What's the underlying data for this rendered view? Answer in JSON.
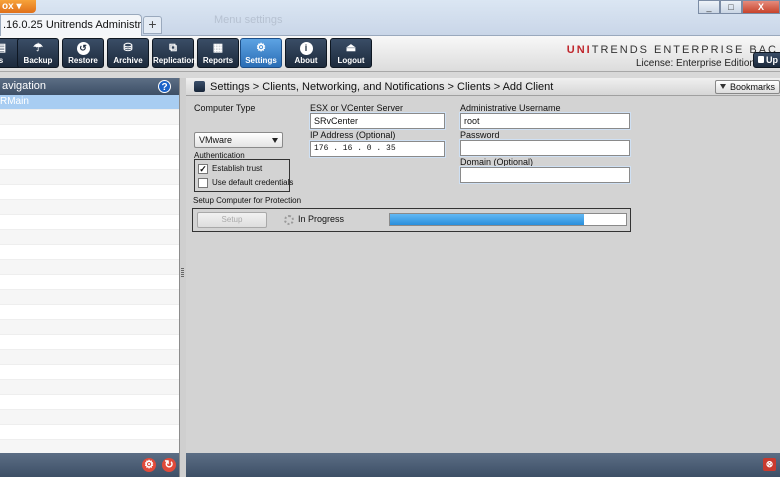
{
  "browser": {
    "menu_label": "ox",
    "tab_title": ".16.0.25 Unitrends Administrator Inter…",
    "new_tab": "+",
    "ghost_tab": "Menu settings",
    "window_buttons": [
      "_",
      "□",
      "X"
    ]
  },
  "toolbar": {
    "buttons": [
      {
        "label": "s",
        "icon": "status-icon"
      },
      {
        "label": "Backup",
        "icon": "umbrella-icon"
      },
      {
        "label": "Restore",
        "icon": "restore-icon"
      },
      {
        "label": "Archive",
        "icon": "archive-icon"
      },
      {
        "label": "Replication",
        "icon": "replication-icon"
      },
      {
        "label": "Reports",
        "icon": "reports-icon"
      },
      {
        "label": "Settings",
        "icon": "gear-icon",
        "active": true
      },
      {
        "label": "About",
        "icon": "info-icon"
      },
      {
        "label": "Logout",
        "icon": "logout-icon"
      }
    ],
    "brand_prefix": "UNI",
    "brand_rest": "TRENDS ENTERPRISE BAC",
    "license": "License: Enterprise Edition",
    "upgrade_label": "Up"
  },
  "navigation": {
    "title": "avigation",
    "selected_item": "RMain",
    "help_label": "?"
  },
  "main": {
    "breadcrumb": "Settings > Clients, Networking, and Notifications > Clients > Add Client",
    "bookmarks_label": "Bookmarks"
  },
  "form": {
    "computer_type_label": "Computer Type",
    "computer_type_value": "VMware",
    "authentication_label": "Authentication",
    "establish_trust_label": "Establish trust",
    "establish_trust_checked": true,
    "use_default_credentials_label": "Use default credentials",
    "use_default_credentials_checked": false,
    "esx_label": "ESX or VCenter Server",
    "esx_value": "SRvCenter",
    "ip_label": "IP Address (Optional)",
    "ip_value": "176  .  16  .  0  .  35",
    "admin_username_label": "Administrative Username",
    "admin_username_value": "root",
    "password_label": "Password",
    "password_value": "",
    "domain_label": "Domain (Optional)",
    "domain_value": "",
    "setup_section_label": "Setup Computer for Protection",
    "setup_button_label": "Setup",
    "progress_text": "In Progress",
    "progress_fraction": 0.82
  },
  "colors": {
    "accent_blue": "#2a8fdc",
    "brand_red": "#c0272d",
    "selected_row": "#a8cdf2"
  }
}
